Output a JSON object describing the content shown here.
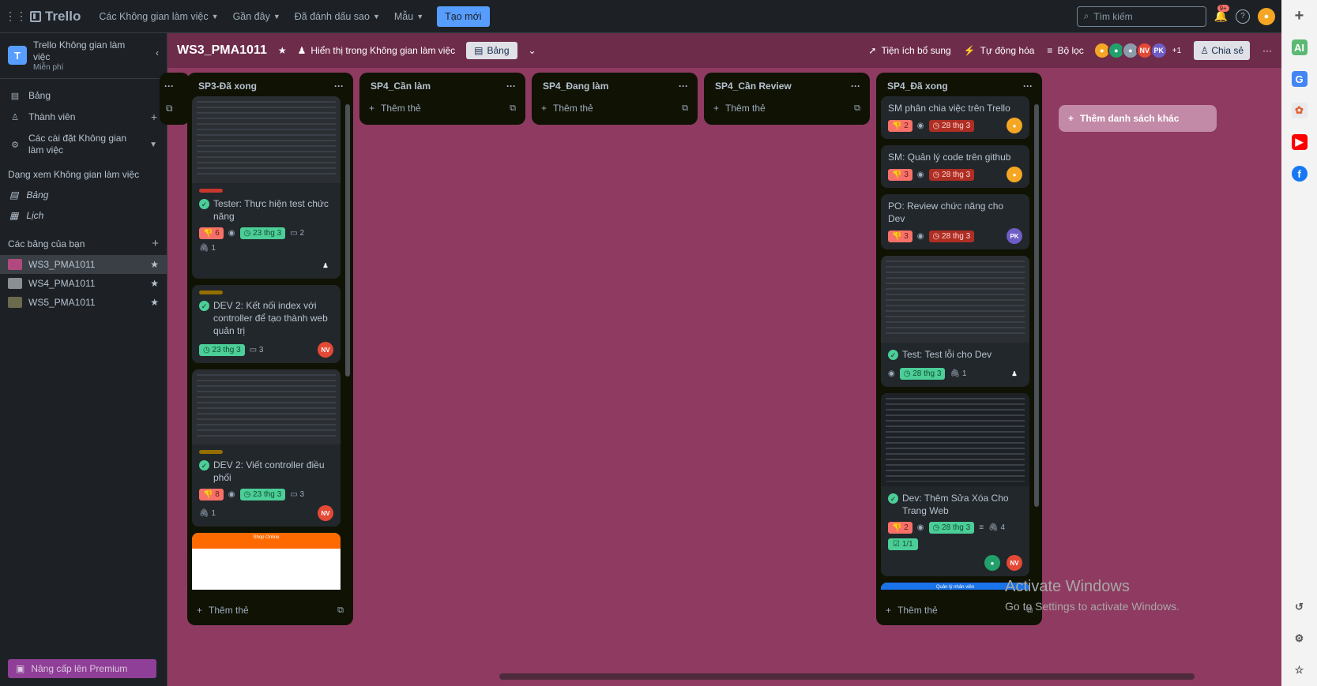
{
  "topbar": {
    "app": "Trello",
    "menus": [
      "Các Không gian làm việc",
      "Gần đây",
      "Đã đánh dấu sao",
      "Mẫu"
    ],
    "create": "Tạo mới",
    "search_placeholder": "Tìm kiếm",
    "notif_count": "9+"
  },
  "sidebar": {
    "workspace_name": "Trello Không gian làm việc",
    "plan": "Miễn phí",
    "items": [
      {
        "label": "Bảng"
      },
      {
        "label": "Thành viên"
      },
      {
        "label": "Các cài đặt Không gian làm việc"
      }
    ],
    "views_title": "Dạng xem Không gian làm việc",
    "views": [
      "Bảng",
      "Lịch"
    ],
    "boards_title": "Các bảng của bạn",
    "boards": [
      "WS3_PMA1011",
      "WS4_PMA1011",
      "WS5_PMA1011"
    ],
    "premium": "Nâng cấp lên Premium"
  },
  "board": {
    "name": "WS3_PMA1011",
    "visibility": "Hiển thị trong Không gian làm việc",
    "view": "Bảng",
    "powerups": "Tiện ích bổ sung",
    "automation": "Tự động hóa",
    "filter": "Bộ lọc",
    "more_members": "+1",
    "share": "Chia sẻ",
    "add_list": "Thêm danh sách khác",
    "add_card": "Thêm thẻ",
    "member_initials": [
      "NV",
      "PK"
    ]
  },
  "lists": [
    {
      "title": "SP3-Đã xong",
      "cards": [
        {
          "title": "Tester: Thực hiện test chức năng",
          "votes": "6",
          "due": "23 thg 3",
          "comments": "2",
          "attach": "1"
        },
        {
          "title": "DEV 2: Kết nối index với controller để tạo thành web quản trị",
          "due": "23 thg 3",
          "comments": "3",
          "member": "NV"
        },
        {
          "title": "DEV 2: Viết controller điều phối",
          "votes": "8",
          "due": "23 thg 3",
          "comments": "3",
          "attach": "1",
          "member": "NV"
        },
        {
          "cover_title": "Shop Online"
        }
      ]
    },
    {
      "title": "SP4_Cần làm"
    },
    {
      "title": "SP4_Đang làm"
    },
    {
      "title": "SP4_Cần Review"
    },
    {
      "title": "SP4_Đã xong",
      "cards": [
        {
          "title": "SM phân chia việc trên Trello",
          "votes": "2",
          "due": "28 thg 3"
        },
        {
          "title": "SM: Quản lý code trên github",
          "votes": "3",
          "due": "28 thg 3"
        },
        {
          "title": "PO: Review chức năng cho Dev",
          "votes": "3",
          "due": "28 thg 3",
          "member": "PK"
        },
        {
          "title": "Test: Test lỗi cho Dev",
          "due": "28 thg 3",
          "attach": "1"
        },
        {
          "title": "Dev: Thêm Sửa Xóa Cho Trang Web",
          "votes": "2",
          "due": "28 thg 3",
          "attach": "4",
          "checklist": "1/1",
          "member": "NV"
        },
        {
          "cover_title": "Quản lý nhân viên"
        }
      ]
    }
  ],
  "watermark": {
    "line1": "Activate Windows",
    "line2": "Go to Settings to activate Windows."
  },
  "colors": {
    "board_bg": "#8e3a61",
    "accent": "#579dff",
    "done": "#4bce97",
    "vote": "#f87168"
  }
}
